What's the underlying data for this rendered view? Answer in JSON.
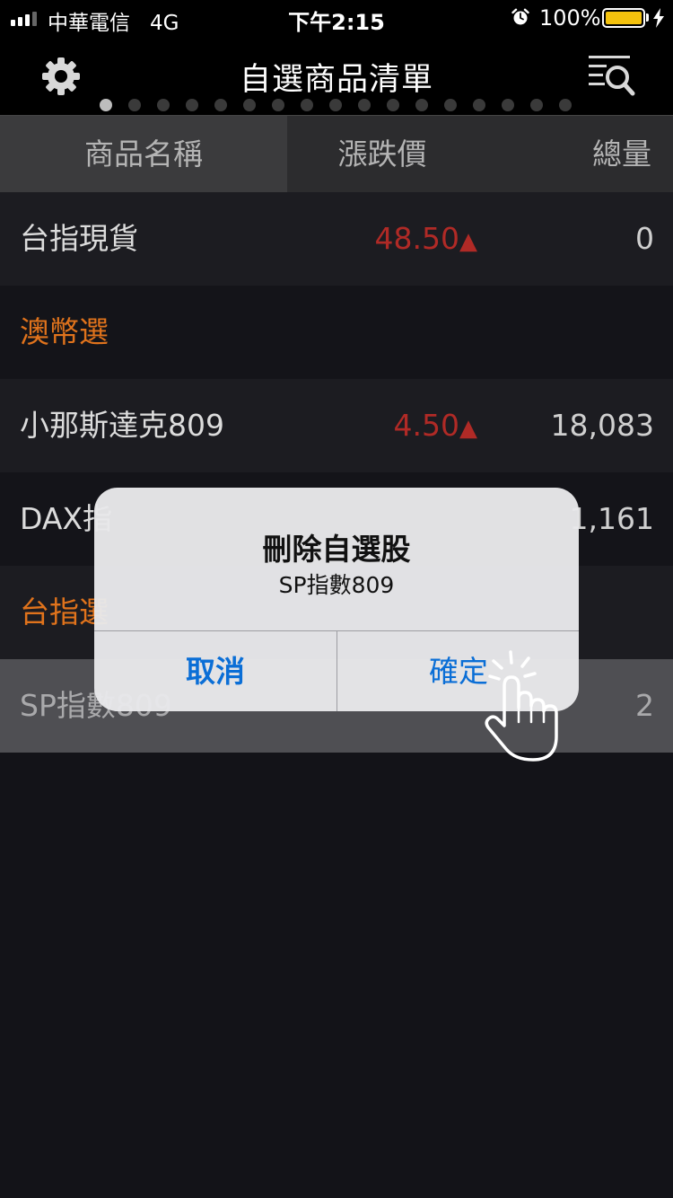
{
  "status_bar": {
    "carrier": "中華電信",
    "network": "4G",
    "time": "下午2:15",
    "battery_percent": "100%",
    "battery_level": 1.0,
    "signal_bars": 3,
    "signal_bars_total": 4,
    "icons": [
      "signal-icon",
      "alarm-icon",
      "battery-icon",
      "charging-bolt-icon"
    ]
  },
  "navbar": {
    "title": "自選商品清單",
    "left_icon": "gear-icon",
    "right_icon": "list-search-icon",
    "page_count": 17,
    "active_page": 1
  },
  "columns": {
    "name": "商品名稱",
    "change": "漲跌價",
    "volume": "總量"
  },
  "rows": [
    {
      "name": "台指現貨",
      "change": "48.50▲",
      "volume": "0",
      "type": "item"
    },
    {
      "name": "澳幣選",
      "change": "",
      "volume": "",
      "type": "group"
    },
    {
      "name": "小那斯達克809",
      "change": "4.50▲",
      "volume": "18,083",
      "type": "item"
    },
    {
      "name": "DAX指",
      "change": "",
      "volume": "1,161",
      "type": "item"
    },
    {
      "name": "台指選",
      "change": "",
      "volume": "",
      "type": "group"
    },
    {
      "name": "SP指數809",
      "change": "",
      "volume": "2",
      "type": "item"
    }
  ],
  "dialog": {
    "title": "刪除自選股",
    "message": "SP指數809",
    "cancel_label": "取消",
    "confirm_label": "確定"
  },
  "colors": {
    "up_red": "#b02a26",
    "group_orange": "#e0731c",
    "button_blue": "#0a6ed6",
    "battery_yellow": "#f4c20d"
  }
}
